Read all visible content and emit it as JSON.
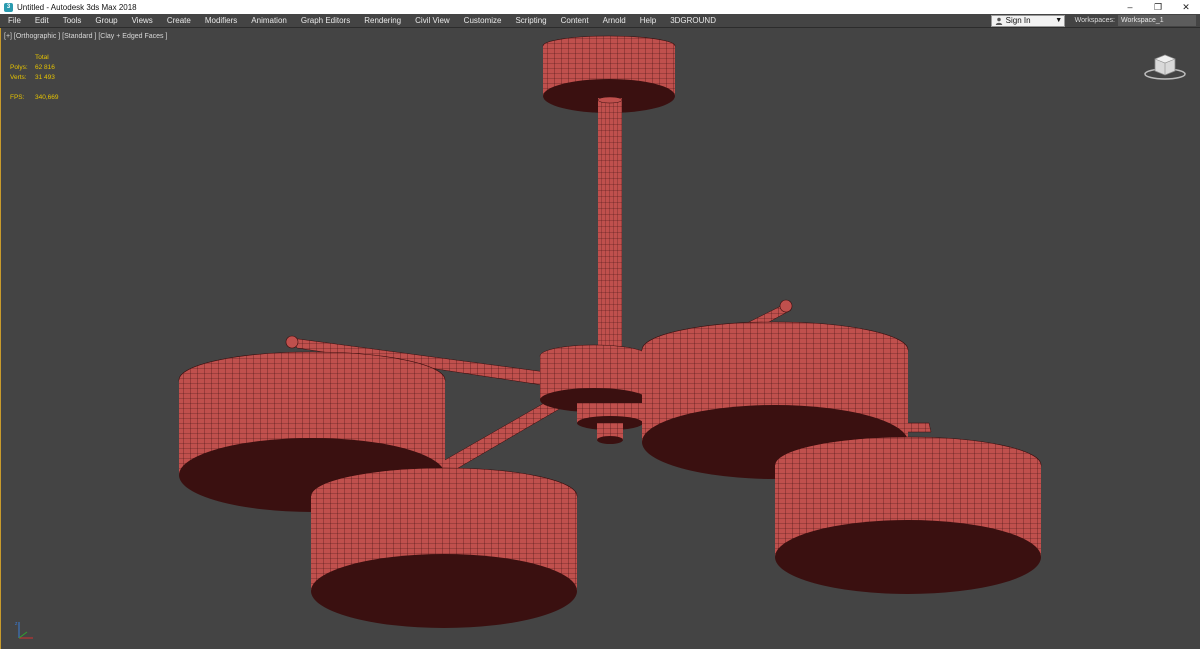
{
  "window": {
    "title": "Untitled - Autodesk 3ds Max 2018",
    "controls": {
      "minimize": "–",
      "restore": "❐",
      "close": "✕"
    }
  },
  "menu": {
    "items": [
      "File",
      "Edit",
      "Tools",
      "Group",
      "Views",
      "Create",
      "Modifiers",
      "Animation",
      "Graph Editors",
      "Rendering",
      "Civil View",
      "Customize",
      "Scripting",
      "Content",
      "Arnold",
      "Help",
      "3DGROUND"
    ],
    "sign_in": "Sign In",
    "workspaces_label": "Workspaces:",
    "workspace_value": "Workspace_1"
  },
  "viewport": {
    "label": "[+] [Orthographic ] [Standard ] [Clay + Edged Faces ]",
    "stats": {
      "header": "Total",
      "polys_label": "Polys:",
      "polys_value": "62 816",
      "verts_label": "Verts:",
      "verts_value": "31 493",
      "fps_label": "FPS:",
      "fps_value": "340,669"
    },
    "model_color": "#c0504d",
    "wire_color": "#3a0e0e",
    "shade_color": "#3a1010"
  },
  "icons": [
    "app-icon",
    "user-icon",
    "dropdown-caret-icon",
    "viewcube-icon",
    "axis-gizmo-icon"
  ]
}
